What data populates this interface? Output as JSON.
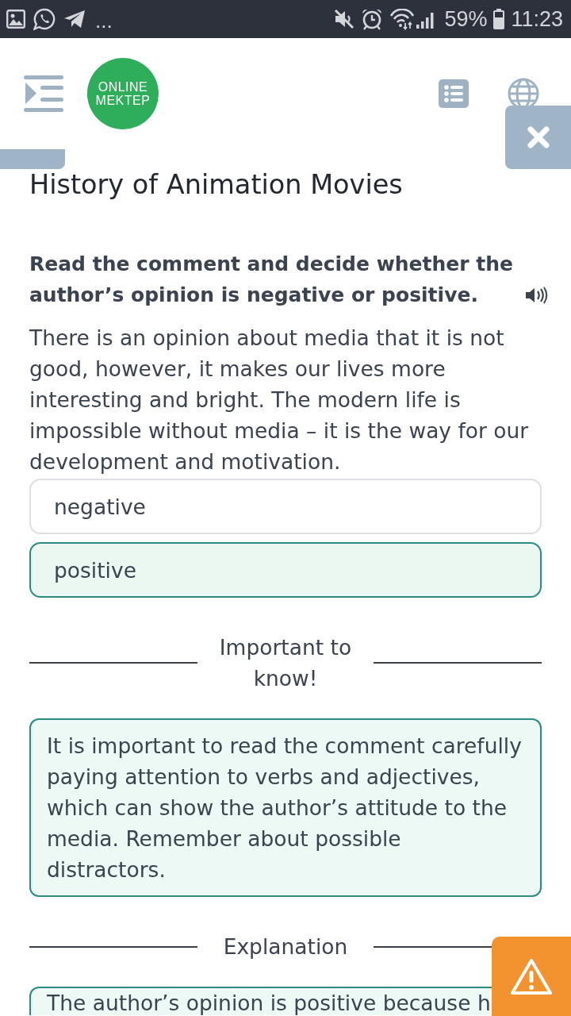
{
  "status_bar": {
    "notification_overflow": "...",
    "battery": "59%",
    "time": "11:23"
  },
  "header": {
    "logo": "ONLINE MEKTEP"
  },
  "lesson": {
    "title": "History of Animation Movies"
  },
  "task": {
    "instruction": "Read the comment and decide whether the author’s opinion is negative or positive.",
    "passage": "There is an opinion about media that it is not good, however, it makes our lives more interesting and bright. The modern life is impossible without media – it is the way for our development and motivation.",
    "options": [
      {
        "label": "negative",
        "selected": false
      },
      {
        "label": "positive",
        "selected": true
      }
    ]
  },
  "sections": [
    {
      "heading": "Important to know!",
      "body": "It is important to read the comment carefully paying attention to verbs and adjectives, which can show the author’s attitude to the media. Remember about possible distractors."
    },
    {
      "heading": "Explanation",
      "body": "The author’s opinion is positive because h"
    }
  ]
}
